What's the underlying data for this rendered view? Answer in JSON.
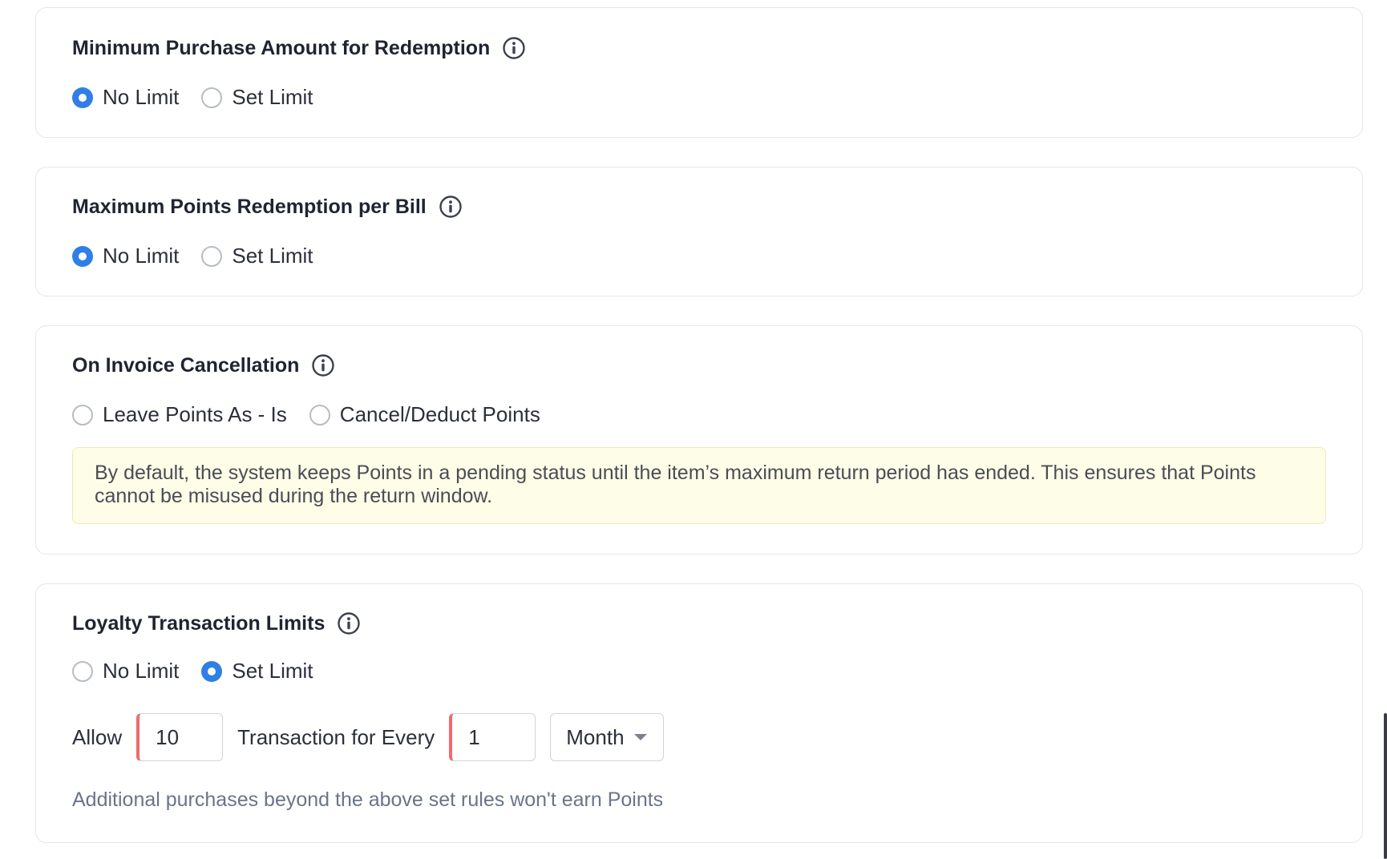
{
  "sections": {
    "min_purchase": {
      "title": "Minimum Purchase Amount for Redemption",
      "options": [
        "No Limit",
        "Set Limit"
      ],
      "selected": "No Limit"
    },
    "max_points": {
      "title": "Maximum Points Redemption per Bill",
      "options": [
        "No Limit",
        "Set Limit"
      ],
      "selected": "No Limit"
    },
    "invoice_cancel": {
      "title": "On Invoice Cancellation",
      "options": [
        "Leave Points As - Is",
        "Cancel/Deduct Points"
      ],
      "selected": null,
      "note": "By default, the system keeps Points in a pending status until the item’s maximum return period has ended. This ensures that Points cannot be misused during the return window."
    },
    "txn_limits": {
      "title": "Loyalty Transaction Limits",
      "options": [
        "No Limit",
        "Set Limit"
      ],
      "selected": "Set Limit",
      "allow_label": "Allow",
      "count_value": "10",
      "every_label": "Transaction for Every",
      "period_value": "1",
      "period_unit": "Month",
      "helper": "Additional purchases beyond the above set rules won't earn Points"
    }
  },
  "icons": {
    "info": "info-circle-icon",
    "caret": "chevron-down-icon"
  },
  "colors": {
    "accent": "#2f7fe6",
    "error_bar": "#ef6b6b",
    "note_bg": "#fefde8"
  }
}
